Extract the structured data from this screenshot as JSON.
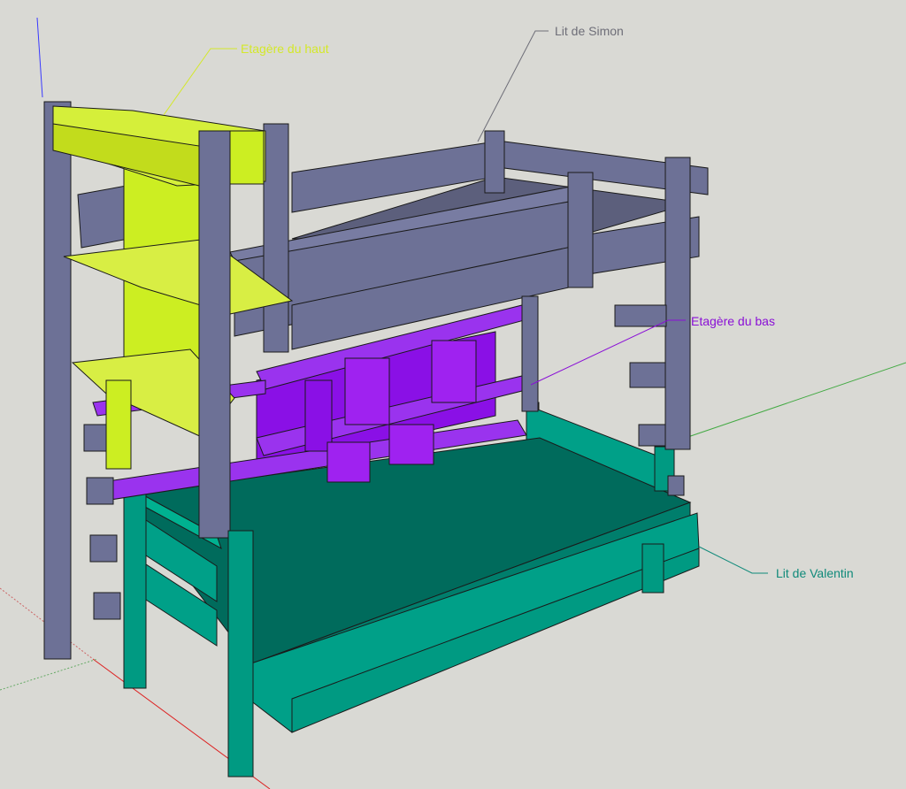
{
  "labels": {
    "top_shelf": "Etagère du haut",
    "simon_bed": "Lit de Simon",
    "bottom_shelf": "Etagère du bas",
    "valentin_bed": "Lit de Valentin"
  },
  "colors": {
    "background": "#d9d9d4",
    "top_shelf": "#ccee22",
    "top_shelf_label": "#d4e82a",
    "simon_bed": "#6d7196",
    "bottom_shelf": "#8a10e6",
    "bottom_shelf_label": "#8a10d6",
    "valentin_bed": "#009a82",
    "valentin_label": "#108a7a",
    "simon_label": "#6e6e78"
  }
}
